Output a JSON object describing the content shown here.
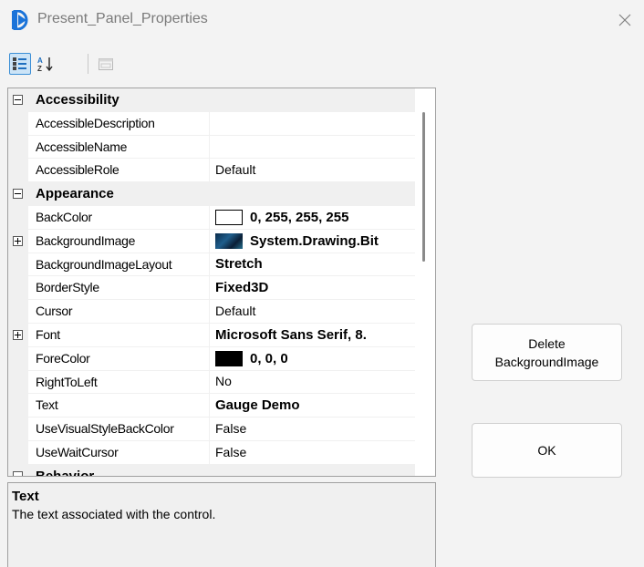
{
  "window": {
    "title": "Present_Panel_Properties"
  },
  "toolbar": {
    "categorized_icon": "categorized-icon",
    "alphabetical_icon": "sort-az-icon",
    "pages_icon": "property-pages-icon"
  },
  "categories": [
    {
      "name": "Accessibility",
      "expanded": true
    },
    {
      "name": "Appearance",
      "expanded": true
    },
    {
      "name": "Behavior",
      "expanded": true
    }
  ],
  "properties": {
    "accessible_description": {
      "name": "AccessibleDescription",
      "value": ""
    },
    "accessible_name": {
      "name": "AccessibleName",
      "value": ""
    },
    "accessible_role": {
      "name": "AccessibleRole",
      "value": "Default"
    },
    "back_color": {
      "name": "BackColor",
      "value": "0, 255, 255, 255",
      "swatch": "#ffffff"
    },
    "background_image": {
      "name": "BackgroundImage",
      "value": "System.Drawing.Bit"
    },
    "background_image_layout": {
      "name": "BackgroundImageLayout",
      "value": "Stretch"
    },
    "border_style": {
      "name": "BorderStyle",
      "value": "Fixed3D"
    },
    "cursor": {
      "name": "Cursor",
      "value": "Default"
    },
    "font": {
      "name": "Font",
      "value": "Microsoft Sans Serif, 8."
    },
    "fore_color": {
      "name": "ForeColor",
      "value": "0, 0, 0",
      "swatch": "#000000"
    },
    "right_to_left": {
      "name": "RightToLeft",
      "value": "No"
    },
    "text": {
      "name": "Text",
      "value": "Gauge Demo"
    },
    "use_visual_style_back_color": {
      "name": "UseVisualStyleBackColor",
      "value": "False"
    },
    "use_wait_cursor": {
      "name": "UseWaitCursor",
      "value": "False"
    }
  },
  "description": {
    "title": "Text",
    "text": "The text associated with the control."
  },
  "buttons": {
    "delete_label": "Delete\nBackgroundImage",
    "ok_label": "OK"
  }
}
